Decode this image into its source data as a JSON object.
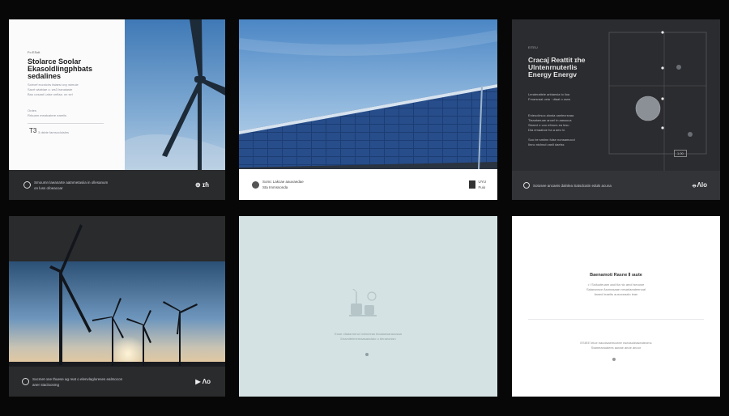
{
  "colors": {
    "background": "#070707",
    "dark_panel": "#2b2c2f",
    "footer_dark": "#333437",
    "sky_blue": "#7da7cf",
    "pale_blue": "#d4e1e2",
    "white": "#ffffff"
  },
  "slides": [
    {
      "eyebrow": "Fo ESolt",
      "title_lines": [
        "Stolarce Soolar",
        "Ekasoldlingphbats",
        "sedalines"
      ],
      "body_lines": [
        "Solrvef eccnicirs faiaesi ovy wimuie",
        "Sacrt wtabiae o. ws3 iranaiaste",
        "Bao ucsaat Lalse onfiaa. on sel",
        "Ordes",
        "Rrkuam meatcatere eareiis"
      ],
      "stat": "T3",
      "stat_caption": "3 dsbie farnsccluisles",
      "footer_text": [
        "Smoumn laeanarte aatnmetasiia in ollesanum",
        "on luss ofoeacoar"
      ],
      "footer_logo": "⊕ ɪɦ",
      "icon_name": "globe-icon"
    },
    {
      "footer_lines": [
        "Somc Lakcae aauvaedae",
        "Sta Immssonda"
      ],
      "footer_tag": [
        "UYU",
        "Fuio"
      ],
      "icon_name": "logo-badge-icon"
    },
    {
      "eyebrow": "EITEU",
      "title_lines": [
        "Cracaĵ Reattit ɪhe",
        "Ulntenrnuterlis",
        "Energy Energv"
      ],
      "body_lines": [
        "Leraleratiele arbiaesia to lioa",
        "Frnarsraal oeia · dtaat o osns",
        "Enleuclirsoc alosta oanlecrsnaa",
        "Tiaaataeuae anoel tn aassuca",
        "Slarecl e cou efmurs ea lesu",
        "Dta emaaboe ha a aes hi.",
        "Soo be smiinn fulse nonsamucol",
        "Ilnno ntclnsd vaslt daelss"
      ],
      "chart_label": "1.00",
      "footer_text": [
        "Sotosee ancaeis dalnlea Satsdcatin eduls acuna"
      ],
      "footer_logo": "⦵Ʌlo",
      "icon_name": "settings-icon"
    },
    {
      "footer_text": [
        "Socmet one thuese ag reat o elenvlagloreses ealmocon",
        "aner stacloosmg"
      ],
      "footer_logo": "▶ Ʌo",
      "icon_name": "globe-icon"
    },
    {
      "caption_lines": [
        "Eose ofadarmrncl rxieneeas hloaiaeoaraoosaa",
        "Eeamiteirnereaasanclaio u beraeonisn"
      ],
      "icon_name": "renewable-energy-icon"
    },
    {
      "heading": "Baenamoti Rasne Ⅱ ıaute",
      "body_lines": [
        "• l Ssiluuteuam aad tla nlo aeol lseuose",
        "Salarannce Asnnasaae nesarlaeateenoal",
        "lianed leaelts ausnceaalo lean"
      ],
      "footer_lines": [
        "ESIEE lelue eacoisaemcotee nseasoleaseateomc",
        "Stameanoaiees aunae anoe anoor"
      ]
    }
  ]
}
